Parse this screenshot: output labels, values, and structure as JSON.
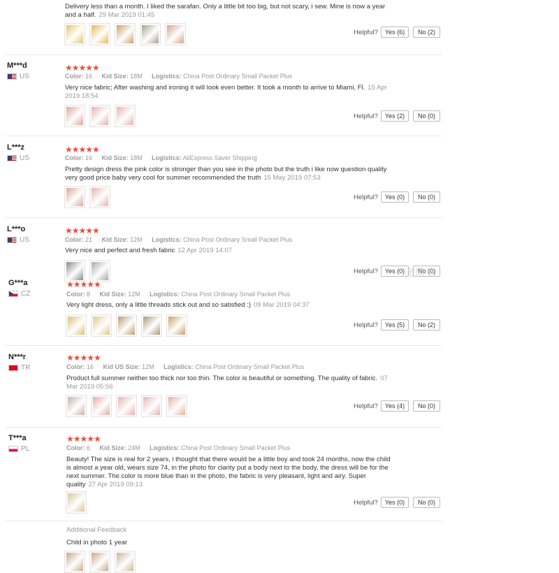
{
  "top": {
    "text": "Delivery less than a month. I liked the sarafan. Only a little bit too big, but not scary, i sew. Mine is now a year and a half.",
    "date": "29 Mar 2019 01:45",
    "helpful_label": "Helpful?",
    "yes": "Yes (6)",
    "no": "No (2)",
    "thumb_colors": [
      "#e3c66e",
      "#e8b85a",
      "#c9a26a",
      "#a8a08a",
      "#d4a48a"
    ]
  },
  "reviews": [
    {
      "user": "M***d",
      "country": "US",
      "stars": "★★★★★",
      "color_label": "Color:",
      "color": "16",
      "size_label": "Kid Size:",
      "size": "18M",
      "log_label": "Logistics:",
      "logistics": "China Post Ordinary Small Packet Plus",
      "text": "Very nice fabric; After washing and ironing it will look even better. It took a month to arrive to Miami, Fl.",
      "date": "15 Apr 2019 18:54",
      "helpful_label": "Helpful?",
      "yes": "Yes (2)",
      "no": "No (0)",
      "thumb_colors": [
        "#d9a79b",
        "#e6b3ac",
        "#e2b4b0"
      ]
    },
    {
      "user": "L***z",
      "country": "US",
      "stars": "★★★★★",
      "color_label": "Color:",
      "color": "16",
      "size_label": "Kid Size:",
      "size": "18M",
      "log_label": "Logistics:",
      "logistics": "AliExpress Saver Shipping",
      "text": "Pretty design dress the pink color is stronger than you see in the photo but the truth i like now question quality very good price baby very cool for summer recommended the truth",
      "date": "15 May 2019 07:53",
      "helpful_label": "Helpful?",
      "yes": "Yes (0)",
      "no": "No (0)",
      "thumb_colors": [
        "#d9a89a",
        "#e2b6ab"
      ]
    },
    {
      "user": "L***o",
      "country": "US",
      "stars": "★★★★★",
      "color_label": "Color:",
      "color": "21",
      "size_label": "Kid Size:",
      "size": "12M",
      "log_label": "Logistics:",
      "logistics": "China Post Ordinary Small Packet Plus",
      "text": "Very nice and perfect and fresh fabric",
      "date": "12 Apr 2019 14:07",
      "helpful_label": "Helpful?",
      "yes": "Yes (0)",
      "no": "No (0)",
      "thumb_colors": [
        "#8a8a8a",
        "#a9a9a9"
      ]
    },
    {
      "user": "G***a",
      "country": "CZ",
      "stars": "★★★★★",
      "color_label": "Color:",
      "color": "8",
      "size_label": "Kid Size:",
      "size": "12M",
      "log_label": "Logistics:",
      "logistics": "China Post Ordinary Small Packet Plus",
      "text": "Very light dress, only a little threads stick out and so satisfied :)",
      "date": "09 Mar 2019 04:37",
      "helpful_label": "Helpful?",
      "yes": "Yes (5)",
      "no": "No (2)",
      "thumb_colors": [
        "#d8c27a",
        "#e0c98a",
        "#b89e70",
        "#a99a78",
        "#c9a266"
      ]
    },
    {
      "user": "N***r",
      "country": "TR",
      "stars": "★★★★★",
      "color_label": "Color:",
      "color": "16",
      "size_label": "Kid US Size:",
      "size": "12M",
      "log_label": "Logistics:",
      "logistics": "China Post Ordinary Small Packet Plus",
      "text": "Product full summer neither too thick nor too thin. The color is beautiful or something. The quality of fabric.",
      "date": "07 Mar 2019 05:56",
      "helpful_label": "Helpful?",
      "yes": "Yes (4)",
      "no": "No (0)",
      "thumb_colors": [
        "#c9b1ad",
        "#e4aaa6",
        "#e7b2ad",
        "#e0b8b4",
        "#e4b0a0"
      ]
    },
    {
      "user": "T***a",
      "country": "PL",
      "stars": "★★★★★",
      "color_label": "Color:",
      "color": "6",
      "size_label": "Kid Size:",
      "size": "24M",
      "log_label": "Logistics:",
      "logistics": "China Post Ordinary Small Packet Plus",
      "text": "Beauty! The size is real for 2 years, i thought that there would be a little boy and took 24 months, now the child is almost a year old, wears size 74, in the photo for clarity put a body next to the body, the dress will be for the next summer. The color is more blue than in the photo, the fabric is very pleasant, light and airy. Super quality",
      "date": "27 Apr 2019 09:13",
      "helpful_label": "Helpful?",
      "yes": "Yes (0)",
      "no": "No (0)",
      "thumb_colors": [
        "#d8c79a"
      ]
    }
  ],
  "additional": {
    "label": "Additional Feedback",
    "text": "Child in photo 1 year",
    "thumb_colors": [
      "#c9a98a",
      "#c8a98e",
      "#d0b49a"
    ]
  },
  "watermark": "激情 W"
}
